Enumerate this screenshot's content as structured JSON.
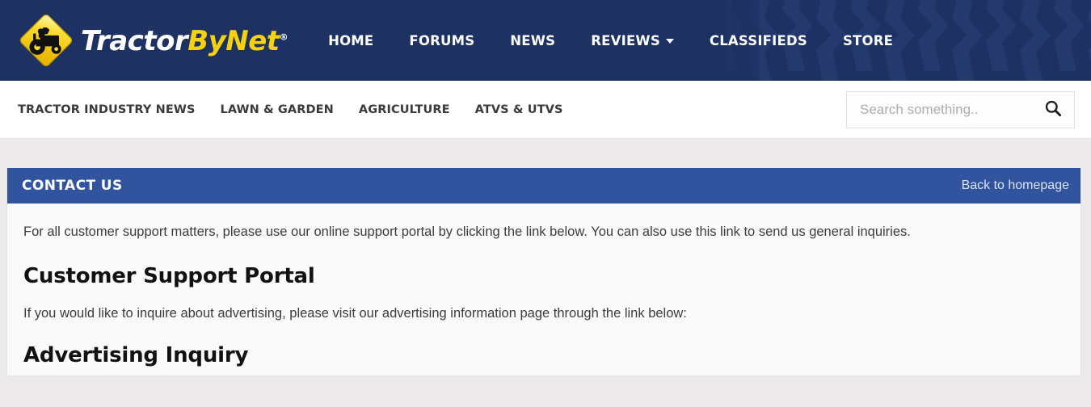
{
  "site": {
    "logo": {
      "icon": "tractor-diamond-logo",
      "text_part1": "Tractor",
      "text_part2": "ByNet",
      "registered_mark": "®"
    },
    "colors": {
      "header_blue": "#1d3263",
      "tread_blue": "#233a6e",
      "panel_blue": "#32549f",
      "logo_yellow": "#f5d211",
      "page_gray": "#eceaea",
      "panel_bg": "#fafafa",
      "body_text": "#3c3c3c"
    }
  },
  "main_nav": {
    "items": [
      {
        "label": "HOME",
        "has_dropdown": false
      },
      {
        "label": "FORUMS",
        "has_dropdown": false
      },
      {
        "label": "NEWS",
        "has_dropdown": false
      },
      {
        "label": "REVIEWS",
        "has_dropdown": true
      },
      {
        "label": "CLASSIFIEDS",
        "has_dropdown": false
      },
      {
        "label": "STORE",
        "has_dropdown": false
      }
    ]
  },
  "sub_nav": {
    "items": [
      {
        "label": "TRACTOR INDUSTRY NEWS"
      },
      {
        "label": "LAWN & GARDEN"
      },
      {
        "label": "AGRICULTURE"
      },
      {
        "label": "ATVS & UTVS"
      }
    ]
  },
  "search": {
    "placeholder": "Search something..",
    "value": "",
    "icon": "search-icon"
  },
  "panel": {
    "title": "CONTACT US",
    "back_link": "Back to homepage",
    "paragraph_1": "For all customer support matters, please use our online support portal by clicking the link below. You can also use this link to send us general inquiries.",
    "heading_1": "Customer Support Portal",
    "paragraph_2": "If you would like to inquire about advertising, please visit our advertising information page through the link below:",
    "heading_2": "Advertising Inquiry"
  }
}
